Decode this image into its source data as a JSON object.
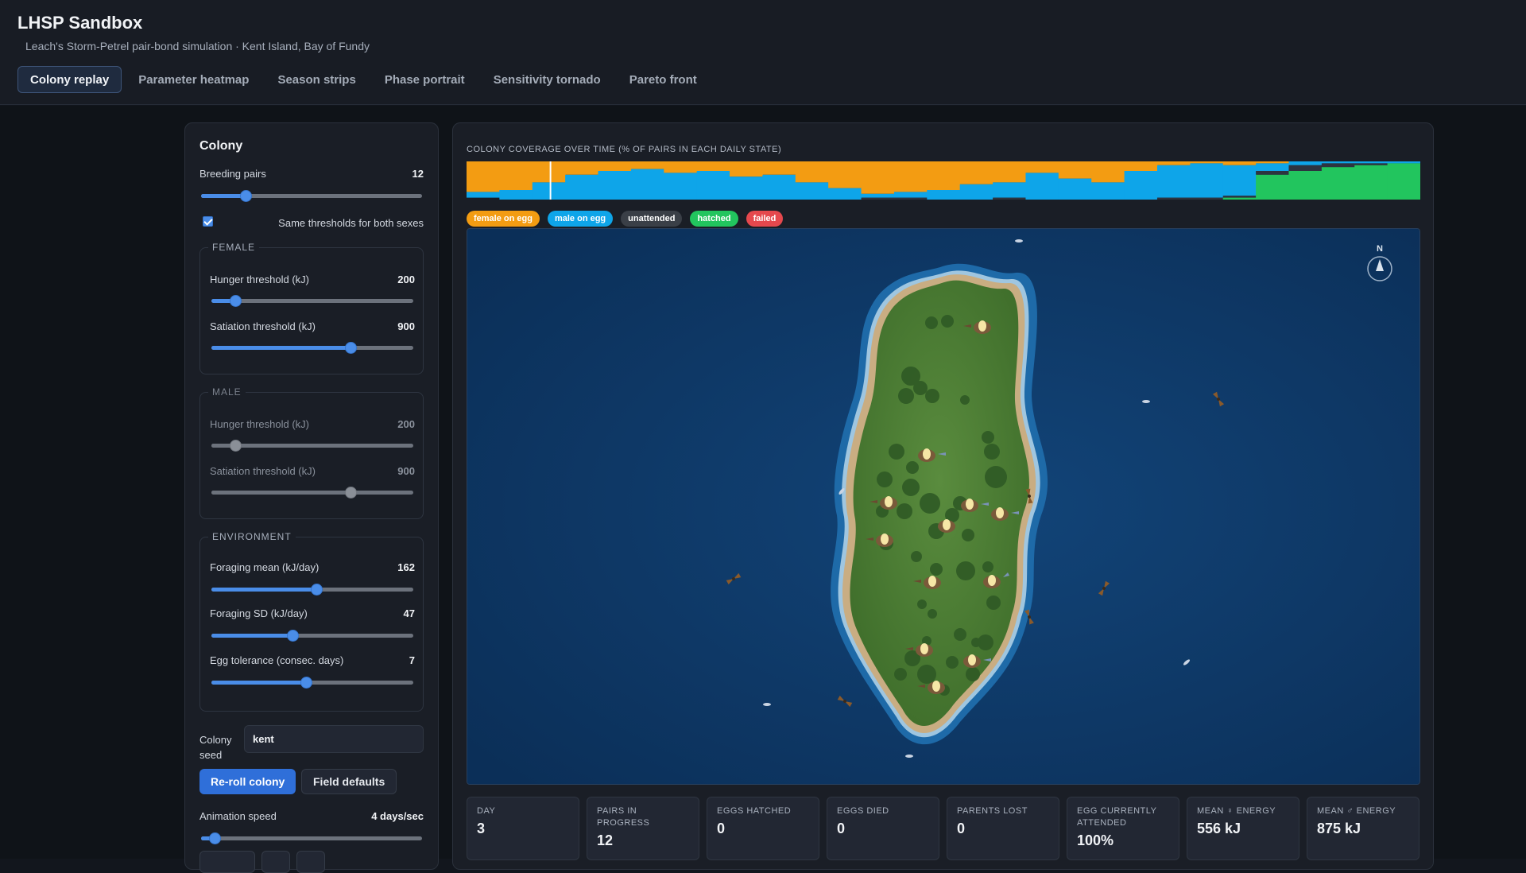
{
  "app": {
    "title": "LHSP Sandbox",
    "subtitle": "Leach's Storm-Petrel pair-bond simulation · Kent Island, Bay of Fundy"
  },
  "tabs": [
    {
      "label": "Colony replay",
      "active": true
    },
    {
      "label": "Parameter heatmap",
      "active": false
    },
    {
      "label": "Season strips",
      "active": false
    },
    {
      "label": "Phase portrait",
      "active": false
    },
    {
      "label": "Sensitivity tornado",
      "active": false
    },
    {
      "label": "Pareto front",
      "active": false
    }
  ],
  "sidebar": {
    "title": "Colony",
    "breeding_pairs": {
      "label": "Breeding pairs",
      "value": "12",
      "fraction": 0.2
    },
    "same_thresholds": {
      "label": "Same thresholds for both sexes",
      "checked": true
    },
    "female": {
      "legend": "FEMALE",
      "hunger": {
        "label": "Hunger threshold (kJ)",
        "value": "200",
        "fraction": 0.12
      },
      "satiation": {
        "label": "Satiation threshold (kJ)",
        "value": "900",
        "fraction": 0.69
      }
    },
    "male": {
      "legend": "MALE",
      "hunger": {
        "label": "Hunger threshold (kJ)",
        "value": "200",
        "fraction": 0.12
      },
      "satiation": {
        "label": "Satiation threshold (kJ)",
        "value": "900",
        "fraction": 0.69
      }
    },
    "environment": {
      "legend": "ENVIRONMENT",
      "foraging_mean": {
        "label": "Foraging mean (kJ/day)",
        "value": "162",
        "fraction": 0.52
      },
      "foraging_sd": {
        "label": "Foraging SD (kJ/day)",
        "value": "47",
        "fraction": 0.4
      },
      "egg_tolerance": {
        "label": "Egg tolerance (consec. days)",
        "value": "7",
        "fraction": 0.47
      }
    },
    "seed": {
      "label": "Colony seed",
      "value": "kent"
    },
    "reroll_label": "Re-roll colony",
    "defaults_label": "Field defaults",
    "animation_speed": {
      "label": "Animation speed",
      "value": "4 days/sec",
      "fraction": 0.06
    }
  },
  "coverage": {
    "title": "COLONY COVERAGE OVER TIME (% OF PAIRS IN EACH DAILY STATE)",
    "current_day_fraction": 0.088,
    "days": [
      {
        "female": 80,
        "male": 15,
        "unattended": 0,
        "hatched": 0
      },
      {
        "female": 75,
        "male": 25,
        "unattended": 0,
        "hatched": 0
      },
      {
        "female": 55,
        "male": 45,
        "unattended": 0,
        "hatched": 0
      },
      {
        "female": 35,
        "male": 65,
        "unattended": 0,
        "hatched": 0
      },
      {
        "female": 25,
        "male": 75,
        "unattended": 0,
        "hatched": 0
      },
      {
        "female": 20,
        "male": 80,
        "unattended": 0,
        "hatched": 0
      },
      {
        "female": 30,
        "male": 70,
        "unattended": 0,
        "hatched": 0
      },
      {
        "female": 25,
        "male": 75,
        "unattended": 0,
        "hatched": 0
      },
      {
        "female": 40,
        "male": 60,
        "unattended": 0,
        "hatched": 0
      },
      {
        "female": 35,
        "male": 65,
        "unattended": 0,
        "hatched": 0
      },
      {
        "female": 55,
        "male": 45,
        "unattended": 0,
        "hatched": 0
      },
      {
        "female": 70,
        "male": 30,
        "unattended": 0,
        "hatched": 0
      },
      {
        "female": 85,
        "male": 10,
        "unattended": 5,
        "hatched": 0
      },
      {
        "female": 80,
        "male": 15,
        "unattended": 5,
        "hatched": 0
      },
      {
        "female": 75,
        "male": 25,
        "unattended": 0,
        "hatched": 0
      },
      {
        "female": 60,
        "male": 40,
        "unattended": 0,
        "hatched": 0
      },
      {
        "female": 55,
        "male": 40,
        "unattended": 5,
        "hatched": 0
      },
      {
        "female": 30,
        "male": 70,
        "unattended": 0,
        "hatched": 0
      },
      {
        "female": 45,
        "male": 55,
        "unattended": 0,
        "hatched": 0
      },
      {
        "female": 55,
        "male": 45,
        "unattended": 0,
        "hatched": 0
      },
      {
        "female": 25,
        "male": 75,
        "unattended": 0,
        "hatched": 0
      },
      {
        "female": 10,
        "male": 85,
        "unattended": 5,
        "hatched": 0
      },
      {
        "female": 5,
        "male": 90,
        "unattended": 5,
        "hatched": 0
      },
      {
        "female": 10,
        "male": 80,
        "unattended": 5,
        "hatched": 5
      },
      {
        "female": 5,
        "male": 20,
        "unattended": 10,
        "hatched": 65
      },
      {
        "female": 0,
        "male": 10,
        "unattended": 15,
        "hatched": 75
      },
      {
        "female": 0,
        "male": 5,
        "unattended": 10,
        "hatched": 85
      },
      {
        "female": 0,
        "male": 5,
        "unattended": 5,
        "hatched": 90
      },
      {
        "female": 0,
        "male": 5,
        "unattended": 0,
        "hatched": 95
      }
    ]
  },
  "legend": [
    {
      "label": "female on egg",
      "color": "#f39c12"
    },
    {
      "label": "male on egg",
      "color": "#0ea5e9"
    },
    {
      "label": "unattended",
      "color": "#3a3f47"
    },
    {
      "label": "hatched",
      "color": "#22c55e"
    },
    {
      "label": "failed",
      "color": "#e5484d"
    }
  ],
  "map": {
    "compass_label": "N",
    "ocean_color": "#0f3a6a",
    "island_color": "#4e7f36"
  },
  "stats": [
    {
      "label": "DAY",
      "value": "3"
    },
    {
      "label": "PAIRS IN PROGRESS",
      "value": "12"
    },
    {
      "label": "EGGS HATCHED",
      "value": "0"
    },
    {
      "label": "EGGS DIED",
      "value": "0"
    },
    {
      "label": "PARENTS LOST",
      "value": "0"
    },
    {
      "label": "EGG CURRENTLY ATTENDED",
      "value": "100%"
    },
    {
      "label": "MEAN ♀ ENERGY",
      "value": "556 kJ"
    },
    {
      "label": "MEAN ♂ ENERGY",
      "value": "875 kJ"
    }
  ]
}
